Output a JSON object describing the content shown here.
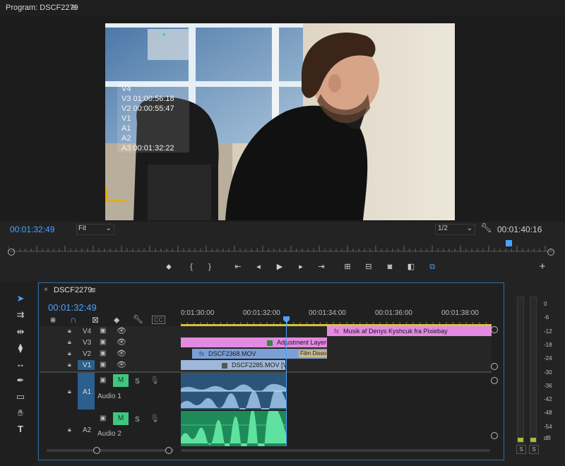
{
  "program": {
    "title": "Program: DSCF2279",
    "menu_icon": "≡",
    "overlay": [
      "V4",
      "V3 01:00:56:18",
      "V2 00:00:55:47",
      "V1",
      "A1",
      "A2",
      "A3 00:01:32:22"
    ],
    "playhead_timecode": "00:01:32:49",
    "fit": "Fit",
    "resolution": "1/2",
    "duration": "00:01:40:16"
  },
  "transport": [
    "{",
    "}"
  ],
  "timeline": {
    "close": "×",
    "name": "DSCF2279",
    "menu_icon": "≡",
    "timecode": "00:01:32:49",
    "cc": "CC",
    "ruler": [
      "0:01:30:00",
      "00:01:32:00",
      "00:01:34:00",
      "00:01:36:00",
      "00:01:38:00"
    ],
    "video_tracks": [
      {
        "label": "V4",
        "target": ""
      },
      {
        "label": "V3",
        "target": ""
      },
      {
        "label": "V2",
        "target": ""
      },
      {
        "label": "V1",
        "target": "V1"
      }
    ],
    "audio_tracks": [
      {
        "label": "A1",
        "name": "Audio 1",
        "m": "M",
        "s": "S"
      },
      {
        "label": "A2",
        "name": "Audio 2",
        "m": "M",
        "s": "S"
      }
    ],
    "clips": {
      "v4": "Musik af Denys Kyshcuk fra Pixiebay",
      "v3": "Adjustment Layer",
      "v2": "DSCF2368.MOV",
      "v2_transition": "Film Disso",
      "v1": "DSCF2285.MOV [V]",
      "fx": "fx"
    }
  },
  "meter": {
    "scale": [
      "0",
      "-6",
      "-12",
      "-18",
      "-24",
      "-30",
      "-36",
      "-42",
      "-48",
      "-54",
      "dB"
    ],
    "solo": [
      "S",
      "S"
    ]
  },
  "colors": {
    "accent": "#4aa3ff",
    "pink": "#e38ae3",
    "blue_clip": "#7ba0d6",
    "audio_blue": "#2b5578",
    "audio_green": "#1e8a5a",
    "m_btn": "#3fc77f"
  }
}
